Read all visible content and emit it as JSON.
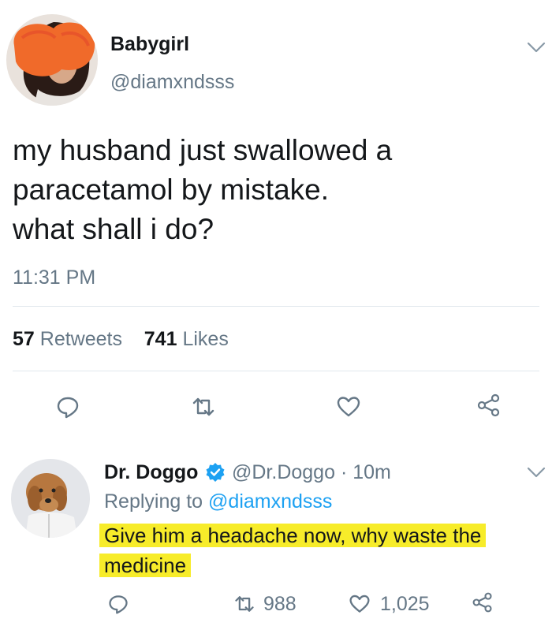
{
  "tweet": {
    "author_name": "Babygirl",
    "author_handle": "@diamxndsss",
    "text": "my husband just swallowed a\nparacetamol by mistake.\nwhat shall i do?",
    "time": "11:31 PM",
    "retweets_count": "57",
    "retweets_label": "Retweets",
    "likes_count": "741",
    "likes_label": "Likes"
  },
  "reply": {
    "author_name": "Dr. Doggo",
    "author_handle": "@Dr.Doggo",
    "time_sep": "·",
    "time_ago": "10m",
    "replying_label": "Replying to",
    "replying_handle": "@diamxndsss",
    "text_line1": "Give him a headache now, why waste the",
    "text_line2": "medicine",
    "retweets": "988",
    "likes": "1,025"
  },
  "colors": {
    "accent": "#1da1f2",
    "muted": "#657786",
    "highlight": "#f7ec2a",
    "avatar_scribble": "#f06a2a"
  },
  "icons": [
    "chevron-down-icon",
    "reply-icon",
    "retweet-icon",
    "like-icon",
    "share-icon",
    "verified-icon"
  ]
}
